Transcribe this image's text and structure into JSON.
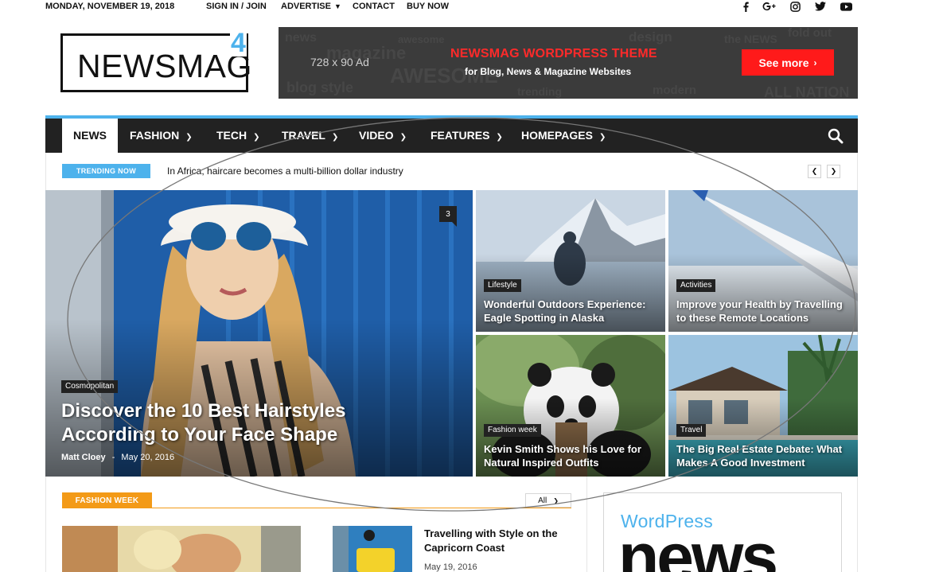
{
  "topbar": {
    "date": "MONDAY, NOVEMBER 19, 2018",
    "links": {
      "signin": "SIGN IN / JOIN",
      "advertise": "ADVERTISE",
      "contact": "CONTACT",
      "buynow": "BUY NOW"
    },
    "social_icons": [
      "facebook-icon",
      "google-plus-icon",
      "instagram-icon",
      "twitter-icon",
      "youtube-icon"
    ]
  },
  "logo": {
    "word": "NEWSMAG",
    "superscript": "4"
  },
  "ad": {
    "size": "728 x 90 Ad",
    "headline": "NEWSMAG WORDPRESS THEME",
    "sub": "for Blog, News & Magazine Websites",
    "cta": "See more"
  },
  "nav": {
    "news": "NEWS",
    "fashion": "FASHION",
    "tech": "TECH",
    "travel": "TRAVEL",
    "video": "VIDEO",
    "features": "FEATURES",
    "homepages": "HOMEPAGES"
  },
  "trending": {
    "label": "TRENDING NOW",
    "headline": "In Africa, haircare becomes a multi-billion dollar industry"
  },
  "featured": {
    "category": "Cosmopolitan",
    "title": "Discover the 10 Best Hairstyles According to Your Face Shape",
    "author": "Matt Cloey",
    "separator": "-",
    "date": "May 20, 2016",
    "comments": "3"
  },
  "tiles": [
    {
      "category": "Lifestyle",
      "title": "Wonderful Outdoors Experience: Eagle Spotting in Alaska"
    },
    {
      "category": "Activities",
      "title": "Improve your Health by Travelling to these Remote Locations"
    },
    {
      "category": "Fashion week",
      "title": "Kevin Smith Shows his Love for Natural Inspired Outfits"
    },
    {
      "category": "Travel",
      "title": "The Big Real Estate Debate: What Makes A Good Investment"
    }
  ],
  "section": {
    "label": "FASHION WEEK",
    "filter": "All"
  },
  "article": {
    "title": "Travelling with Style on the Capricorn Coast",
    "date": "May 19, 2016"
  },
  "widget": {
    "line1": "WordPress",
    "line2": "news"
  },
  "colors": {
    "accent": "#4db2ec",
    "ad_red": "#ff1a1a",
    "section_orange": "#f39a17",
    "nav_bg": "#222222"
  }
}
